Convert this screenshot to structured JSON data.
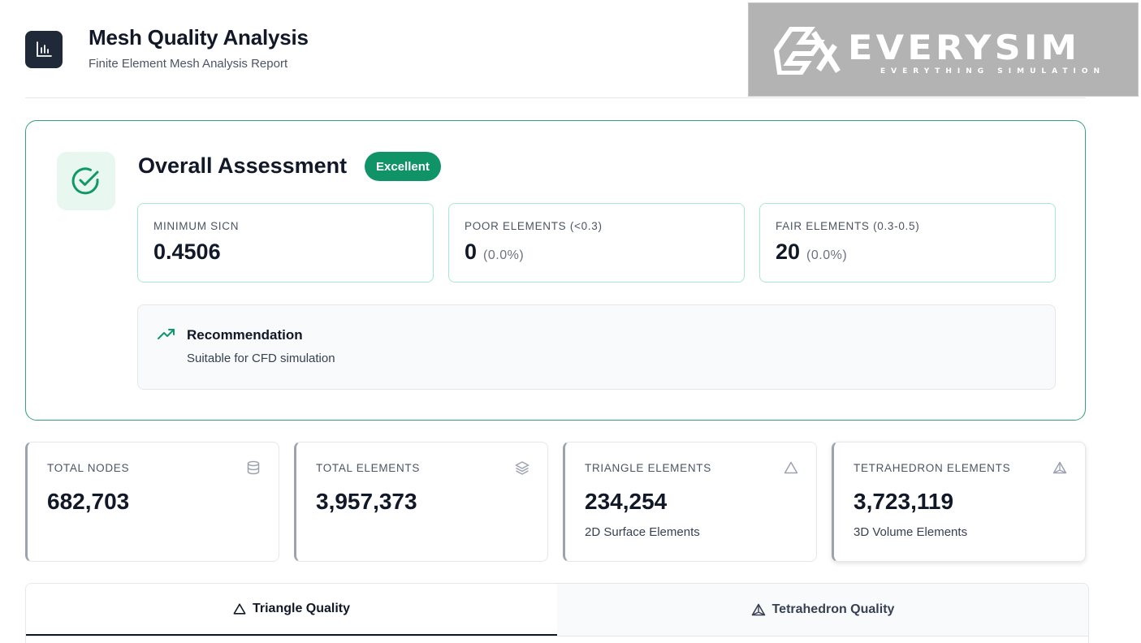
{
  "header": {
    "title": "Mesh Quality Analysis",
    "subtitle": "Finite Element Mesh Analysis Report",
    "app_icon": "bar-chart-icon"
  },
  "logo": {
    "wordmark": "EVERYSIM",
    "tagline": "EVERYTHING SIMULATION"
  },
  "assessment": {
    "title": "Overall Assessment",
    "badge": "Excellent",
    "badge_color": "#109366",
    "icon": "check-circle-icon",
    "metrics": [
      {
        "label": "MINIMUM SICN",
        "value": "0.4506",
        "pct": ""
      },
      {
        "label": "POOR ELEMENTS (<0.3)",
        "value": "0",
        "pct": "(0.0%)"
      },
      {
        "label": "FAIR ELEMENTS (0.3-0.5)",
        "value": "20",
        "pct": "(0.0%)"
      }
    ],
    "recommendation": {
      "icon": "trending-up-icon",
      "title": "Recommendation",
      "text": "Suitable for CFD simulation"
    }
  },
  "stats": [
    {
      "label": "TOTAL NODES",
      "value": "682,703",
      "sub": "",
      "icon": "database-icon"
    },
    {
      "label": "TOTAL ELEMENTS",
      "value": "3,957,373",
      "sub": "",
      "icon": "layers-icon"
    },
    {
      "label": "TRIANGLE ELEMENTS",
      "value": "234,254",
      "sub": "2D Surface Elements",
      "icon": "triangle-icon"
    },
    {
      "label": "TETRAHEDRON ELEMENTS",
      "value": "3,723,119",
      "sub": "3D Volume Elements",
      "icon": "tetrahedron-icon"
    }
  ],
  "tabs": [
    {
      "label": "Triangle Quality",
      "icon": "triangle-icon",
      "active": true
    },
    {
      "label": "Tetrahedron Quality",
      "icon": "tetrahedron-icon",
      "active": false
    }
  ],
  "colors": {
    "accent_green": "#109366",
    "card_border": "#34a37a",
    "metric_border": "#a7ead2"
  }
}
